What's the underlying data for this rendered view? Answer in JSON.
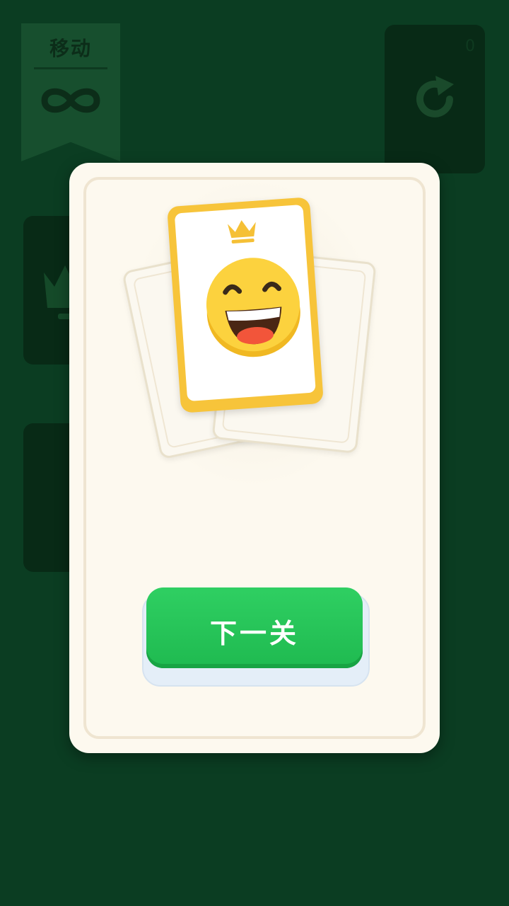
{
  "hud": {
    "moves_label": "移动",
    "moves_icon": "infinity-icon",
    "restart_icon": "restart-icon",
    "restart_corner_text": "0"
  },
  "result_modal": {
    "card_icon": "laughing-face-icon",
    "crown_icon": "crown-icon",
    "next_button_label": "下一关"
  },
  "colors": {
    "background": "#0b3d22",
    "modal": "#fdf9ef",
    "card_border": "#f7c43a",
    "button": "#22c357"
  }
}
